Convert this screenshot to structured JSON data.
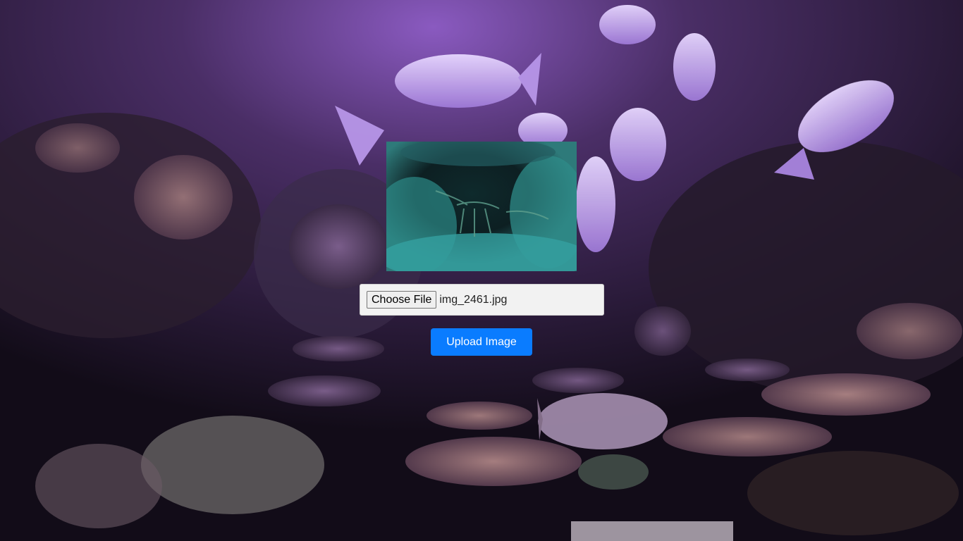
{
  "background": {
    "alt": "coral-reef-aquarium-background"
  },
  "preview": {
    "alt": "underwater-lobster-preview"
  },
  "upload_form": {
    "choose_file_label": "Choose File",
    "file_name": "img_2461.jpg",
    "upload_button_label": "Upload Image"
  },
  "colors": {
    "accent": "#0a7cff",
    "file_box_bg": "#f2f2f2"
  }
}
